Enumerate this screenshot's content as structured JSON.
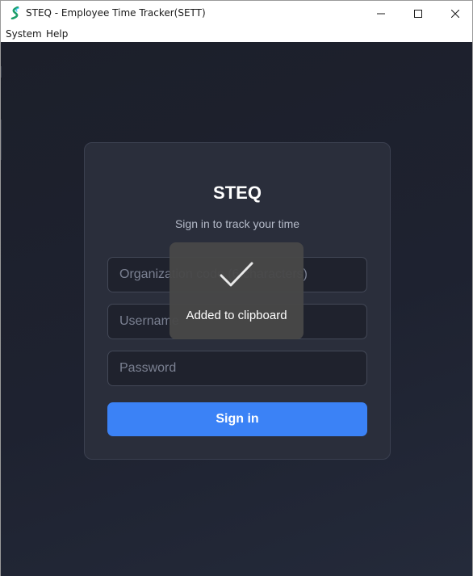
{
  "window": {
    "title": "STEQ - Employee Time Tracker(SETT)",
    "icon": "steq-app-icon"
  },
  "menu": {
    "items": [
      {
        "label": "System"
      },
      {
        "label": "Help"
      }
    ]
  },
  "login": {
    "title": "STEQ",
    "subtitle": "Sign in to track your time",
    "organization_placeholder": "Organization code (6 characters)",
    "username_placeholder": "Username",
    "password_placeholder": "Password",
    "signin_label": "Sign in"
  },
  "toast": {
    "message": "Added to clipboard",
    "icon": "check-icon"
  },
  "colors": {
    "background": "#1e2230",
    "card": "#2a2e3b",
    "accent": "#3b82f6",
    "toast": "#484848"
  }
}
